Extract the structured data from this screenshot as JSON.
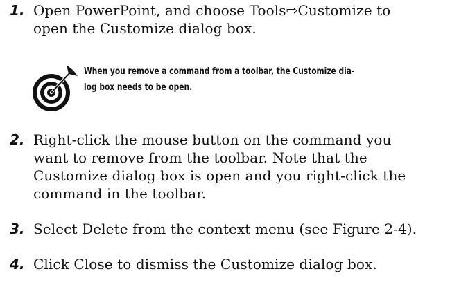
{
  "steps": [
    {
      "number": "1.",
      "lines": [
        "Open PowerPoint, and choose Tools⇨Customize to",
        "open the Customize dialog box."
      ]
    },
    {
      "number": "2.",
      "lines": [
        "Right-click the mouse button on the command you",
        "want to remove from the toolbar. Note that the",
        "Customize dialog box is open and you right-click the",
        "command in the toolbar."
      ]
    },
    {
      "number": "3.",
      "lines": [
        "Select Delete from the context menu (see Figure 2-4)."
      ]
    },
    {
      "number": "4.",
      "lines": [
        "Click Close to dismiss the Customize dialog box."
      ]
    }
  ],
  "tip": {
    "icon": "target-dart-icon",
    "lines": [
      "When you remove a command from a toolbar, the Customize dia-",
      "log box needs to be open."
    ]
  }
}
